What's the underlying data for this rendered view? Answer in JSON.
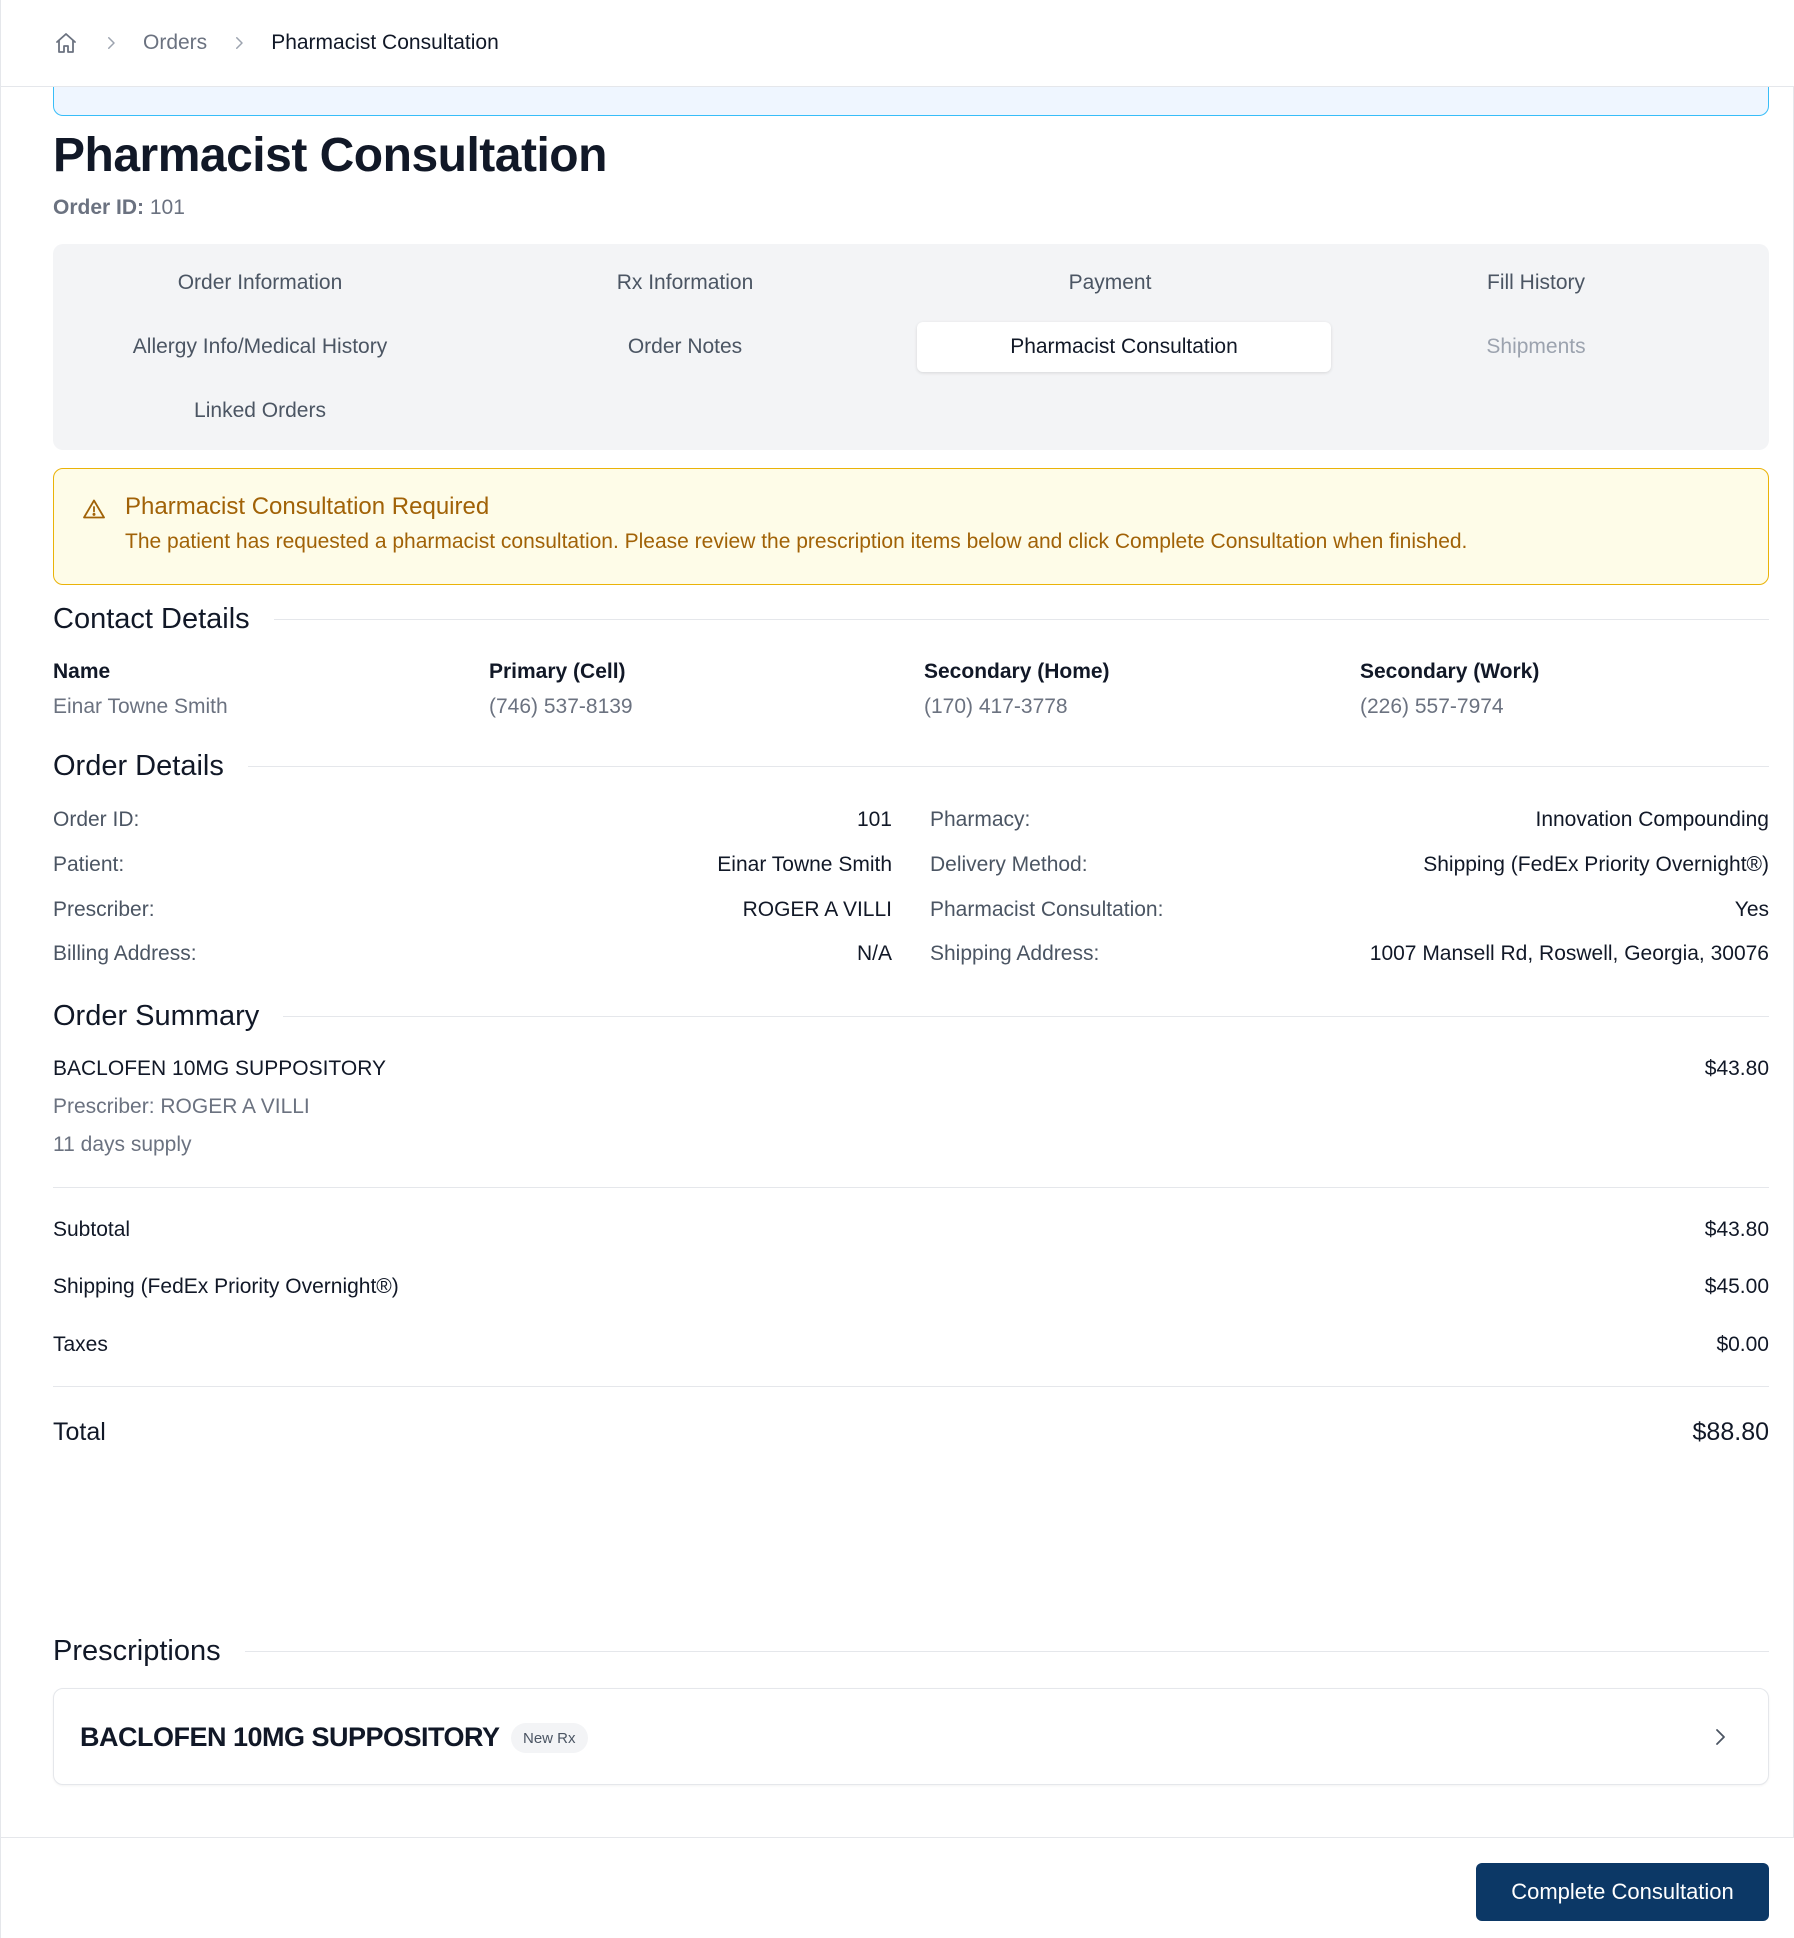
{
  "breadcrumb": {
    "home_icon": "home-icon",
    "orders": "Orders",
    "current": "Pharmacist Consultation"
  },
  "page": {
    "title": "Pharmacist Consultation",
    "order_id_label": "Order ID:",
    "order_id_value": "101"
  },
  "tabs": [
    {
      "label": "Order Information",
      "state": "normal"
    },
    {
      "label": "Rx Information",
      "state": "normal"
    },
    {
      "label": "Payment",
      "state": "normal"
    },
    {
      "label": "Fill History",
      "state": "normal"
    },
    {
      "label": "Allergy Info/Medical History",
      "state": "normal"
    },
    {
      "label": "Order Notes",
      "state": "normal"
    },
    {
      "label": "Pharmacist Consultation",
      "state": "active"
    },
    {
      "label": "Shipments",
      "state": "disabled"
    },
    {
      "label": "Linked Orders",
      "state": "normal"
    }
  ],
  "alert": {
    "icon": "warning-triangle-icon",
    "title": "Pharmacist Consultation Required",
    "text": "The patient has requested a pharmacist consultation. Please review the prescription items below and click Complete Consultation when finished.",
    "color": "#a16207"
  },
  "contact": {
    "heading": "Contact Details",
    "fields": [
      {
        "label": "Name",
        "value": "Einar Towne Smith"
      },
      {
        "label": "Primary (Cell)",
        "value": "(746) 537-8139"
      },
      {
        "label": "Secondary (Home)",
        "value": "(170) 417-3778"
      },
      {
        "label": "Secondary (Work)",
        "value": "(226) 557-7974"
      }
    ]
  },
  "order_details": {
    "heading": "Order Details",
    "left": [
      {
        "label": "Order ID:",
        "value": "101"
      },
      {
        "label": "Patient:",
        "value": "Einar Towne Smith"
      },
      {
        "label": "Prescriber:",
        "value": "ROGER A VILLI"
      },
      {
        "label": "Billing Address:",
        "value": "N/A"
      }
    ],
    "right": [
      {
        "label": "Pharmacy:",
        "value": "Innovation Compounding"
      },
      {
        "label": "Delivery Method:",
        "value": "Shipping (FedEx Priority Overnight®)"
      },
      {
        "label": "Pharmacist Consultation:",
        "value": "Yes"
      },
      {
        "label": "Shipping Address:",
        "value": "1007 Mansell Rd, Roswell, Georgia, 30076"
      }
    ]
  },
  "order_summary": {
    "heading": "Order Summary",
    "item": {
      "name": "BACLOFEN 10MG SUPPOSITORY",
      "price": "$43.80",
      "prescriber": "Prescriber: ROGER A VILLI",
      "supply": "11 days supply"
    },
    "subtotal_label": "Subtotal",
    "subtotal_value": "$43.80",
    "shipping_label": "Shipping (FedEx Priority Overnight®)",
    "shipping_value": "$45.00",
    "taxes_label": "Taxes",
    "taxes_value": "$0.00",
    "total_label": "Total",
    "total_value": "$88.80"
  },
  "prescriptions": {
    "heading": "Prescriptions",
    "items": [
      {
        "name": "BACLOFEN 10MG SUPPOSITORY",
        "badge": "New Rx",
        "chevron_icon": "chevron-right-icon"
      }
    ]
  },
  "footer": {
    "complete_button": "Complete Consultation",
    "button_color": "#0c3866"
  }
}
